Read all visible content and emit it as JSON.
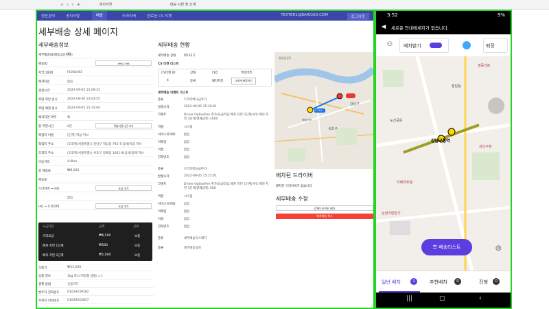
{
  "browser": {
    "tab1": "배차지연",
    "tab2": "대모 시연 및 소개"
  },
  "topnav": {
    "items": [
      "정산관리",
      "공지사항",
      "배송",
      "드라이버",
      "완료된 CS 티켓"
    ],
    "user": "TESTER1@BAROGO.COM",
    "logout": "로그아웃"
  },
  "page_title": "세부배송 상세 페이지",
  "info": {
    "title": "세부배송정보",
    "rows": [
      {
        "k": "세부배송ID(배송고유번호)",
        "v": "11"
      },
      {
        "k": "배송ID",
        "v": "",
        "btn": "9ffa2798"
      },
      {
        "k": "지역그룹ID",
        "v": "fd10bd43"
      },
      {
        "k": "배차타입",
        "v": "없음"
      },
      {
        "k": "생성시각",
        "v": "2022-09-05 15:09:31"
      },
      {
        "k": "픽업 희망 일시",
        "v": "2022-08-30 14:03:55"
      },
      {
        "k": "픽업 예정 일시",
        "v": "2022-09-05 15:13:04"
      },
      {
        "k": "배차지연 여부",
        "v": "예"
      },
      {
        "k": "총 지연시간",
        "v": "0분",
        "btn": "픽업지연시간 추가"
      },
      {
        "k": "픽업지 이름",
        "v": "[인계] 역삼 허브"
      },
      {
        "k": "픽업지 주소",
        "v": "(도로명)서울특별시 강남구 역삼동 792-7(상세)역삼 허브"
      },
      {
        "k": "도착지 주소",
        "v": "(도로명)서울특별시 서초구 방배동 1001-8(상세)방배 허브"
      },
      {
        "k": "이동거리",
        "v": "4.0km"
      },
      {
        "k": "총 배송료",
        "v": "₩8,000"
      },
      {
        "k": "배송료",
        "v": ""
      },
      {
        "k": "드라이버 → HQ",
        "v": "",
        "btn": "요금 추가"
      },
      {
        "k": "",
        "v": "없음"
      },
      {
        "k": "HQ → 드라이버",
        "v": "",
        "btn": "요금 추가"
      }
    ],
    "fee_table": {
      "headers": [
        "요금타입",
        "금액",
        "상태"
      ],
      "rows": [
        [
          "거리요금",
          "₩6,500",
          "보증"
        ],
        [
          "배차 지연 1단계",
          "₩500",
          "보증"
        ],
        [
          "배차 지연 2단계",
          "₩1,000",
          "보증"
        ]
      ]
    },
    "rows2": [
      {
        "k": "상품가",
        "v": "₩12,000"
      },
      {
        "k": "상품 정보",
        "v": "1kg 박스(취정품 샘플) x 1"
      },
      {
        "k": "결제 방법",
        "v": "신용카드"
      },
      {
        "k": "발주자 전화번호",
        "v": "01019239582"
      },
      {
        "k": "수령자 전화번호",
        "v": "01039203857"
      }
    ]
  },
  "status": {
    "title": "세부배송 현황",
    "state_label": "세부배송 상태",
    "state_value": "배차대기",
    "cs_list": "CS 티켓 리스트",
    "cs_headers": [
      "CS티켓 ID",
      "상태",
      "타입",
      "액션버튼"
    ],
    "cs_row": [
      "4",
      "등록",
      "배차지연",
      "나에게 배정하기"
    ],
    "event_list": "세부배송 이벤트 리스트",
    "events": [
      {
        "rows": [
          [
            "종류",
            "드라이버요금추가"
          ],
          [
            "발생시각",
            "2022-09-05 15:20:01"
          ],
          [
            "코멘트",
            "Driver OptionFee 추가(요금타입:배차 지연 2단계/사유:배차 지연 2단계/결제금액:-1000"
          ],
          [
            "역할",
            "시스템"
          ],
          [
            "서비스유저ID",
            "없음"
          ],
          [
            "이메일",
            "없음"
          ],
          [
            "이름",
            "없음"
          ],
          [
            "전화번호",
            "없음"
          ]
        ]
      },
      {
        "rows": [
          [
            "종류",
            "드라이버요금추가"
          ],
          [
            "발생시각",
            "2022-09-05 15:15:01"
          ],
          [
            "코멘트",
            "Driver OptionFee 추가(요금타입:배차 지연 1단계/사유:배차 지연 1단계/결제금액:-500"
          ],
          [
            "역할",
            "시스템"
          ],
          [
            "서비스유저ID",
            "없음"
          ],
          [
            "이메일",
            "없음"
          ],
          [
            "이름",
            "없음"
          ],
          [
            "전화번호",
            "없음"
          ]
        ]
      }
    ],
    "collapsed": [
      [
        "종류",
        "세부배송디스패치"
      ],
      [
        "종류",
        "세부배송생성"
      ]
    ]
  },
  "assigned": {
    "title": "배차된 드라이버",
    "empty": "배차된 드라이버가 없습니다",
    "edit_title": "세부배송 수정",
    "btn_force": "강제드라이버 배차",
    "btn_cancel": "배차배송 취소"
  },
  "map": {
    "labels": [
      "동부간선도",
      "강남구",
      "서초구",
      "배송허브"
    ],
    "pin": "3.1km"
  },
  "phone": {
    "time": "3:52",
    "battery": "9%",
    "notice": "새로운 안내메세지가 없습니다.",
    "toggle_label": "배차받기",
    "exit": "퇴장",
    "list_btn": "배송리스트",
    "tabs": [
      {
        "label": "일반 배차",
        "count": "1"
      },
      {
        "label": "추천배차",
        "count": "0"
      },
      {
        "label": "진행",
        "count": "0"
      }
    ],
    "map_labels": [
      "영동대로",
      "청담동",
      "도산공원",
      "강남구청역",
      "강남구청",
      "서울세관",
      "주민센터",
      "GS25",
      "역삼동",
      "우리병원",
      "논현이편한가",
      "언주로",
      "학동사거리",
      "GS25",
      "리베라호텔"
    ]
  },
  "colors": {
    "nav": "#3a46a8",
    "green_frame": "#22d622",
    "accent": "#5a3ee0"
  }
}
